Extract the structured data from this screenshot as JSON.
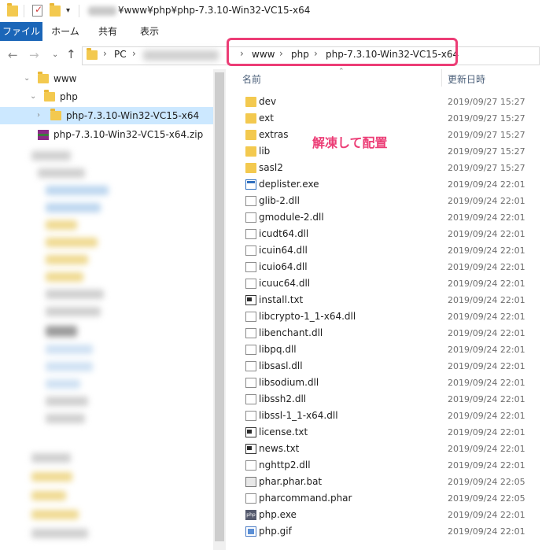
{
  "window": {
    "title": "¥www¥php¥php-7.3.10-Win32-VC15-x64"
  },
  "ribbon": {
    "tabs": [
      "ファイル",
      "ホーム",
      "共有",
      "表示"
    ]
  },
  "address": {
    "crumbs": [
      "PC",
      "www",
      "php",
      "php-7.3.10-Win32-VC15-x64"
    ]
  },
  "tree": {
    "items": [
      {
        "label": "www"
      },
      {
        "label": "php"
      },
      {
        "label": "php-7.3.10-Win32-VC15-x64"
      },
      {
        "label": "php-7.3.10-Win32-VC15-x64.zip"
      }
    ]
  },
  "columns": {
    "name": "名前",
    "date": "更新日時"
  },
  "files": [
    {
      "name": "dev",
      "date": "2019/09/27 15:27",
      "icon": "folder-icon"
    },
    {
      "name": "ext",
      "date": "2019/09/27 15:27",
      "icon": "folder-icon"
    },
    {
      "name": "extras",
      "date": "2019/09/27 15:27",
      "icon": "folder-icon"
    },
    {
      "name": "lib",
      "date": "2019/09/27 15:27",
      "icon": "folder-icon"
    },
    {
      "name": "sasl2",
      "date": "2019/09/27 15:27",
      "icon": "folder-icon"
    },
    {
      "name": "deplister.exe",
      "date": "2019/09/24 22:01",
      "icon": "exe-icon"
    },
    {
      "name": "glib-2.dll",
      "date": "2019/09/24 22:01",
      "icon": "dll-icon"
    },
    {
      "name": "gmodule-2.dll",
      "date": "2019/09/24 22:01",
      "icon": "dll-icon"
    },
    {
      "name": "icudt64.dll",
      "date": "2019/09/24 22:01",
      "icon": "dll-icon"
    },
    {
      "name": "icuin64.dll",
      "date": "2019/09/24 22:01",
      "icon": "dll-icon"
    },
    {
      "name": "icuio64.dll",
      "date": "2019/09/24 22:01",
      "icon": "dll-icon"
    },
    {
      "name": "icuuc64.dll",
      "date": "2019/09/24 22:01",
      "icon": "dll-icon"
    },
    {
      "name": "install.txt",
      "date": "2019/09/24 22:01",
      "icon": "text-file-icon"
    },
    {
      "name": "libcrypto-1_1-x64.dll",
      "date": "2019/09/24 22:01",
      "icon": "dll-icon"
    },
    {
      "name": "libenchant.dll",
      "date": "2019/09/24 22:01",
      "icon": "dll-icon"
    },
    {
      "name": "libpq.dll",
      "date": "2019/09/24 22:01",
      "icon": "dll-icon"
    },
    {
      "name": "libsasl.dll",
      "date": "2019/09/24 22:01",
      "icon": "dll-icon"
    },
    {
      "name": "libsodium.dll",
      "date": "2019/09/24 22:01",
      "icon": "dll-icon"
    },
    {
      "name": "libssh2.dll",
      "date": "2019/09/24 22:01",
      "icon": "dll-icon"
    },
    {
      "name": "libssl-1_1-x64.dll",
      "date": "2019/09/24 22:01",
      "icon": "dll-icon"
    },
    {
      "name": "license.txt",
      "date": "2019/09/24 22:01",
      "icon": "text-file-icon"
    },
    {
      "name": "news.txt",
      "date": "2019/09/24 22:01",
      "icon": "text-file-icon"
    },
    {
      "name": "nghttp2.dll",
      "date": "2019/09/24 22:01",
      "icon": "dll-icon"
    },
    {
      "name": "phar.phar.bat",
      "date": "2019/09/24 22:05",
      "icon": "batch-file-icon"
    },
    {
      "name": "pharcommand.phar",
      "date": "2019/09/24 22:05",
      "icon": "file-icon"
    },
    {
      "name": "php.exe",
      "date": "2019/09/24 22:01",
      "icon": "php-exe-icon"
    },
    {
      "name": "php.gif",
      "date": "2019/09/24 22:01",
      "icon": "image-file-icon"
    }
  ],
  "annotation": {
    "text": "解凍して配置"
  },
  "colors": {
    "accent": "#1b66b8",
    "highlight": "#ec3d76",
    "selection": "#cce8ff",
    "folder": "#f3c94f"
  }
}
